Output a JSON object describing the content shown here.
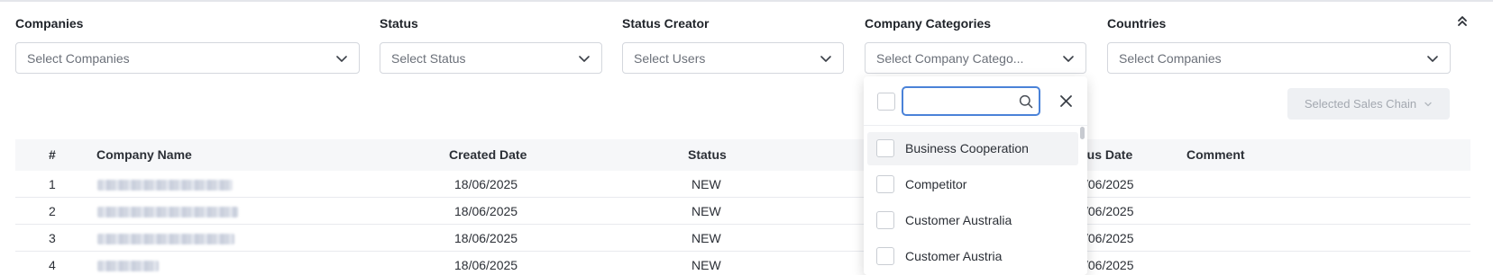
{
  "filters": [
    {
      "label": "Companies",
      "placeholder": "Select Companies"
    },
    {
      "label": "Status",
      "placeholder": "Select Status"
    },
    {
      "label": "Status Creator",
      "placeholder": "Select Users"
    },
    {
      "label": "Company Categories",
      "placeholder": "Select Company Catego..."
    },
    {
      "label": "Countries",
      "placeholder": "Select Companies"
    }
  ],
  "icons": {
    "collapse": "chevrons-up-icon",
    "dropdown": "chevron-down-icon",
    "search": "search-icon",
    "close": "close-icon"
  },
  "sales_chain": {
    "label": "Selected Sales Chain"
  },
  "dropdown": {
    "search_value": "",
    "items": [
      {
        "label": "Business Cooperation",
        "checked": false,
        "highlighted": true
      },
      {
        "label": "Competitor",
        "checked": false
      },
      {
        "label": "Customer Australia",
        "checked": false
      },
      {
        "label": "Customer Austria",
        "checked": false
      }
    ]
  },
  "table": {
    "headers": {
      "index": "#",
      "company_name": "Company Name",
      "created_date": "Created Date",
      "status": "Status",
      "status_date": "tus Date",
      "comment": "Comment"
    },
    "rows": [
      {
        "index": "1",
        "created_date": "18/06/2025",
        "status": "NEW",
        "status_date": "/06/2025"
      },
      {
        "index": "2",
        "created_date": "18/06/2025",
        "status": "NEW",
        "status_date": "/06/2025"
      },
      {
        "index": "3",
        "created_date": "18/06/2025",
        "status": "NEW",
        "status_date": "/06/2025"
      },
      {
        "index": "4",
        "created_date": "18/06/2025",
        "status": "NEW",
        "status_date": "/06/2025"
      }
    ]
  }
}
